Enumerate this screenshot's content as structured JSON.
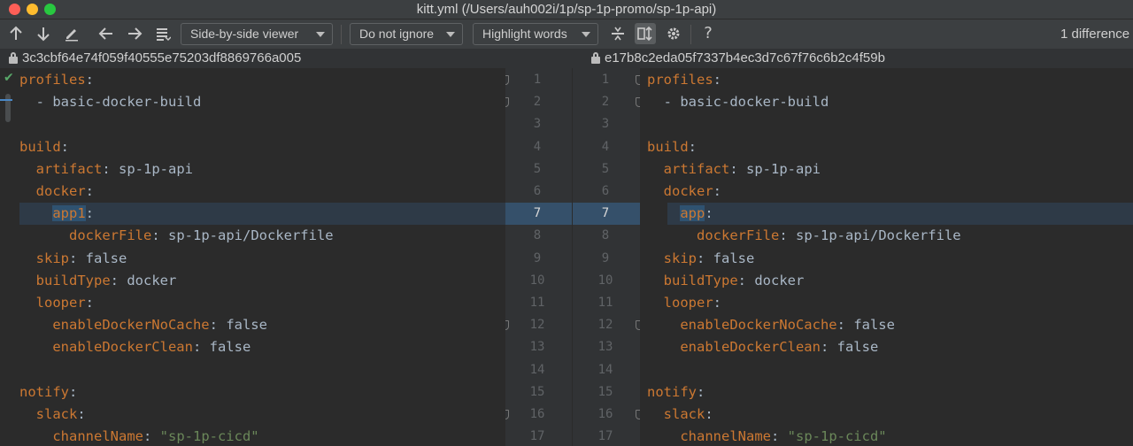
{
  "window": {
    "title": "kitt.yml (/Users/auh002i/1p/sp-1p-promo/sp-1p-api)"
  },
  "toolbar": {
    "viewer_mode": "Side-by-side viewer",
    "ignore_mode": "Do not ignore",
    "highlight_mode": "Highlight words",
    "help_label": "?",
    "difference_count": "1 difference"
  },
  "hashes": {
    "left": "3c3cbf64e74f059f40555e75203df8869766a005",
    "right": "e17b8c2eda05f7337b4ec3d7c67f76c6b2c4f59b"
  },
  "left_lines": [
    {
      "indent": "",
      "key": "profiles",
      "sep": ":",
      "value": ""
    },
    {
      "indent": "  ",
      "key": "",
      "sep": "",
      "value": "- basic-docker-build"
    },
    {
      "indent": "",
      "key": "",
      "sep": "",
      "value": ""
    },
    {
      "indent": "",
      "key": "build",
      "sep": ":",
      "value": ""
    },
    {
      "indent": "  ",
      "key": "artifact",
      "sep": ": ",
      "value": "sp-1p-api"
    },
    {
      "indent": "  ",
      "key": "docker",
      "sep": ":",
      "value": ""
    },
    {
      "indent": "    ",
      "key": "app1",
      "sep": ":",
      "value": ""
    },
    {
      "indent": "      ",
      "key": "dockerFile",
      "sep": ": ",
      "value": "sp-1p-api/Dockerfile"
    },
    {
      "indent": "  ",
      "key": "skip",
      "sep": ": ",
      "value": "false"
    },
    {
      "indent": "  ",
      "key": "buildType",
      "sep": ": ",
      "value": "docker"
    },
    {
      "indent": "  ",
      "key": "looper",
      "sep": ":",
      "value": ""
    },
    {
      "indent": "    ",
      "key": "enableDockerNoCache",
      "sep": ": ",
      "value": "false"
    },
    {
      "indent": "    ",
      "key": "enableDockerClean",
      "sep": ": ",
      "value": "false"
    },
    {
      "indent": "",
      "key": "",
      "sep": "",
      "value": ""
    },
    {
      "indent": "",
      "key": "notify",
      "sep": ":",
      "value": ""
    },
    {
      "indent": "  ",
      "key": "slack",
      "sep": ":",
      "value": ""
    },
    {
      "indent": "    ",
      "key": "channelName",
      "sep": ": ",
      "value": "\"sp-1p-cicd\""
    }
  ],
  "right_lines": [
    {
      "indent": "",
      "key": "profiles",
      "sep": ":",
      "value": ""
    },
    {
      "indent": "  ",
      "key": "",
      "sep": "",
      "value": "- basic-docker-build"
    },
    {
      "indent": "",
      "key": "",
      "sep": "",
      "value": ""
    },
    {
      "indent": "",
      "key": "build",
      "sep": ":",
      "value": ""
    },
    {
      "indent": "  ",
      "key": "artifact",
      "sep": ": ",
      "value": "sp-1p-api"
    },
    {
      "indent": "  ",
      "key": "docker",
      "sep": ":",
      "value": ""
    },
    {
      "indent": "    ",
      "key": "app",
      "sep": ":",
      "value": ""
    },
    {
      "indent": "      ",
      "key": "dockerFile",
      "sep": ": ",
      "value": "sp-1p-api/Dockerfile"
    },
    {
      "indent": "  ",
      "key": "skip",
      "sep": ": ",
      "value": "false"
    },
    {
      "indent": "  ",
      "key": "buildType",
      "sep": ": ",
      "value": "docker"
    },
    {
      "indent": "  ",
      "key": "looper",
      "sep": ":",
      "value": ""
    },
    {
      "indent": "    ",
      "key": "enableDockerNoCache",
      "sep": ": ",
      "value": "false"
    },
    {
      "indent": "    ",
      "key": "enableDockerClean",
      "sep": ": ",
      "value": "false"
    },
    {
      "indent": "",
      "key": "",
      "sep": "",
      "value": ""
    },
    {
      "indent": "",
      "key": "notify",
      "sep": ":",
      "value": ""
    },
    {
      "indent": "  ",
      "key": "slack",
      "sep": ":",
      "value": ""
    },
    {
      "indent": "    ",
      "key": "channelName",
      "sep": ": ",
      "value": "\"sp-1p-cicd\""
    }
  ],
  "line_numbers": [
    "1",
    "2",
    "3",
    "4",
    "5",
    "6",
    "7",
    "8",
    "9",
    "10",
    "11",
    "12",
    "13",
    "14",
    "15",
    "16",
    "17"
  ],
  "changed_line": 7,
  "colors": {
    "key": "#cc7832",
    "value": "#a9b7c6",
    "string": "#6a8759",
    "changed_bg": "#2f5270"
  }
}
